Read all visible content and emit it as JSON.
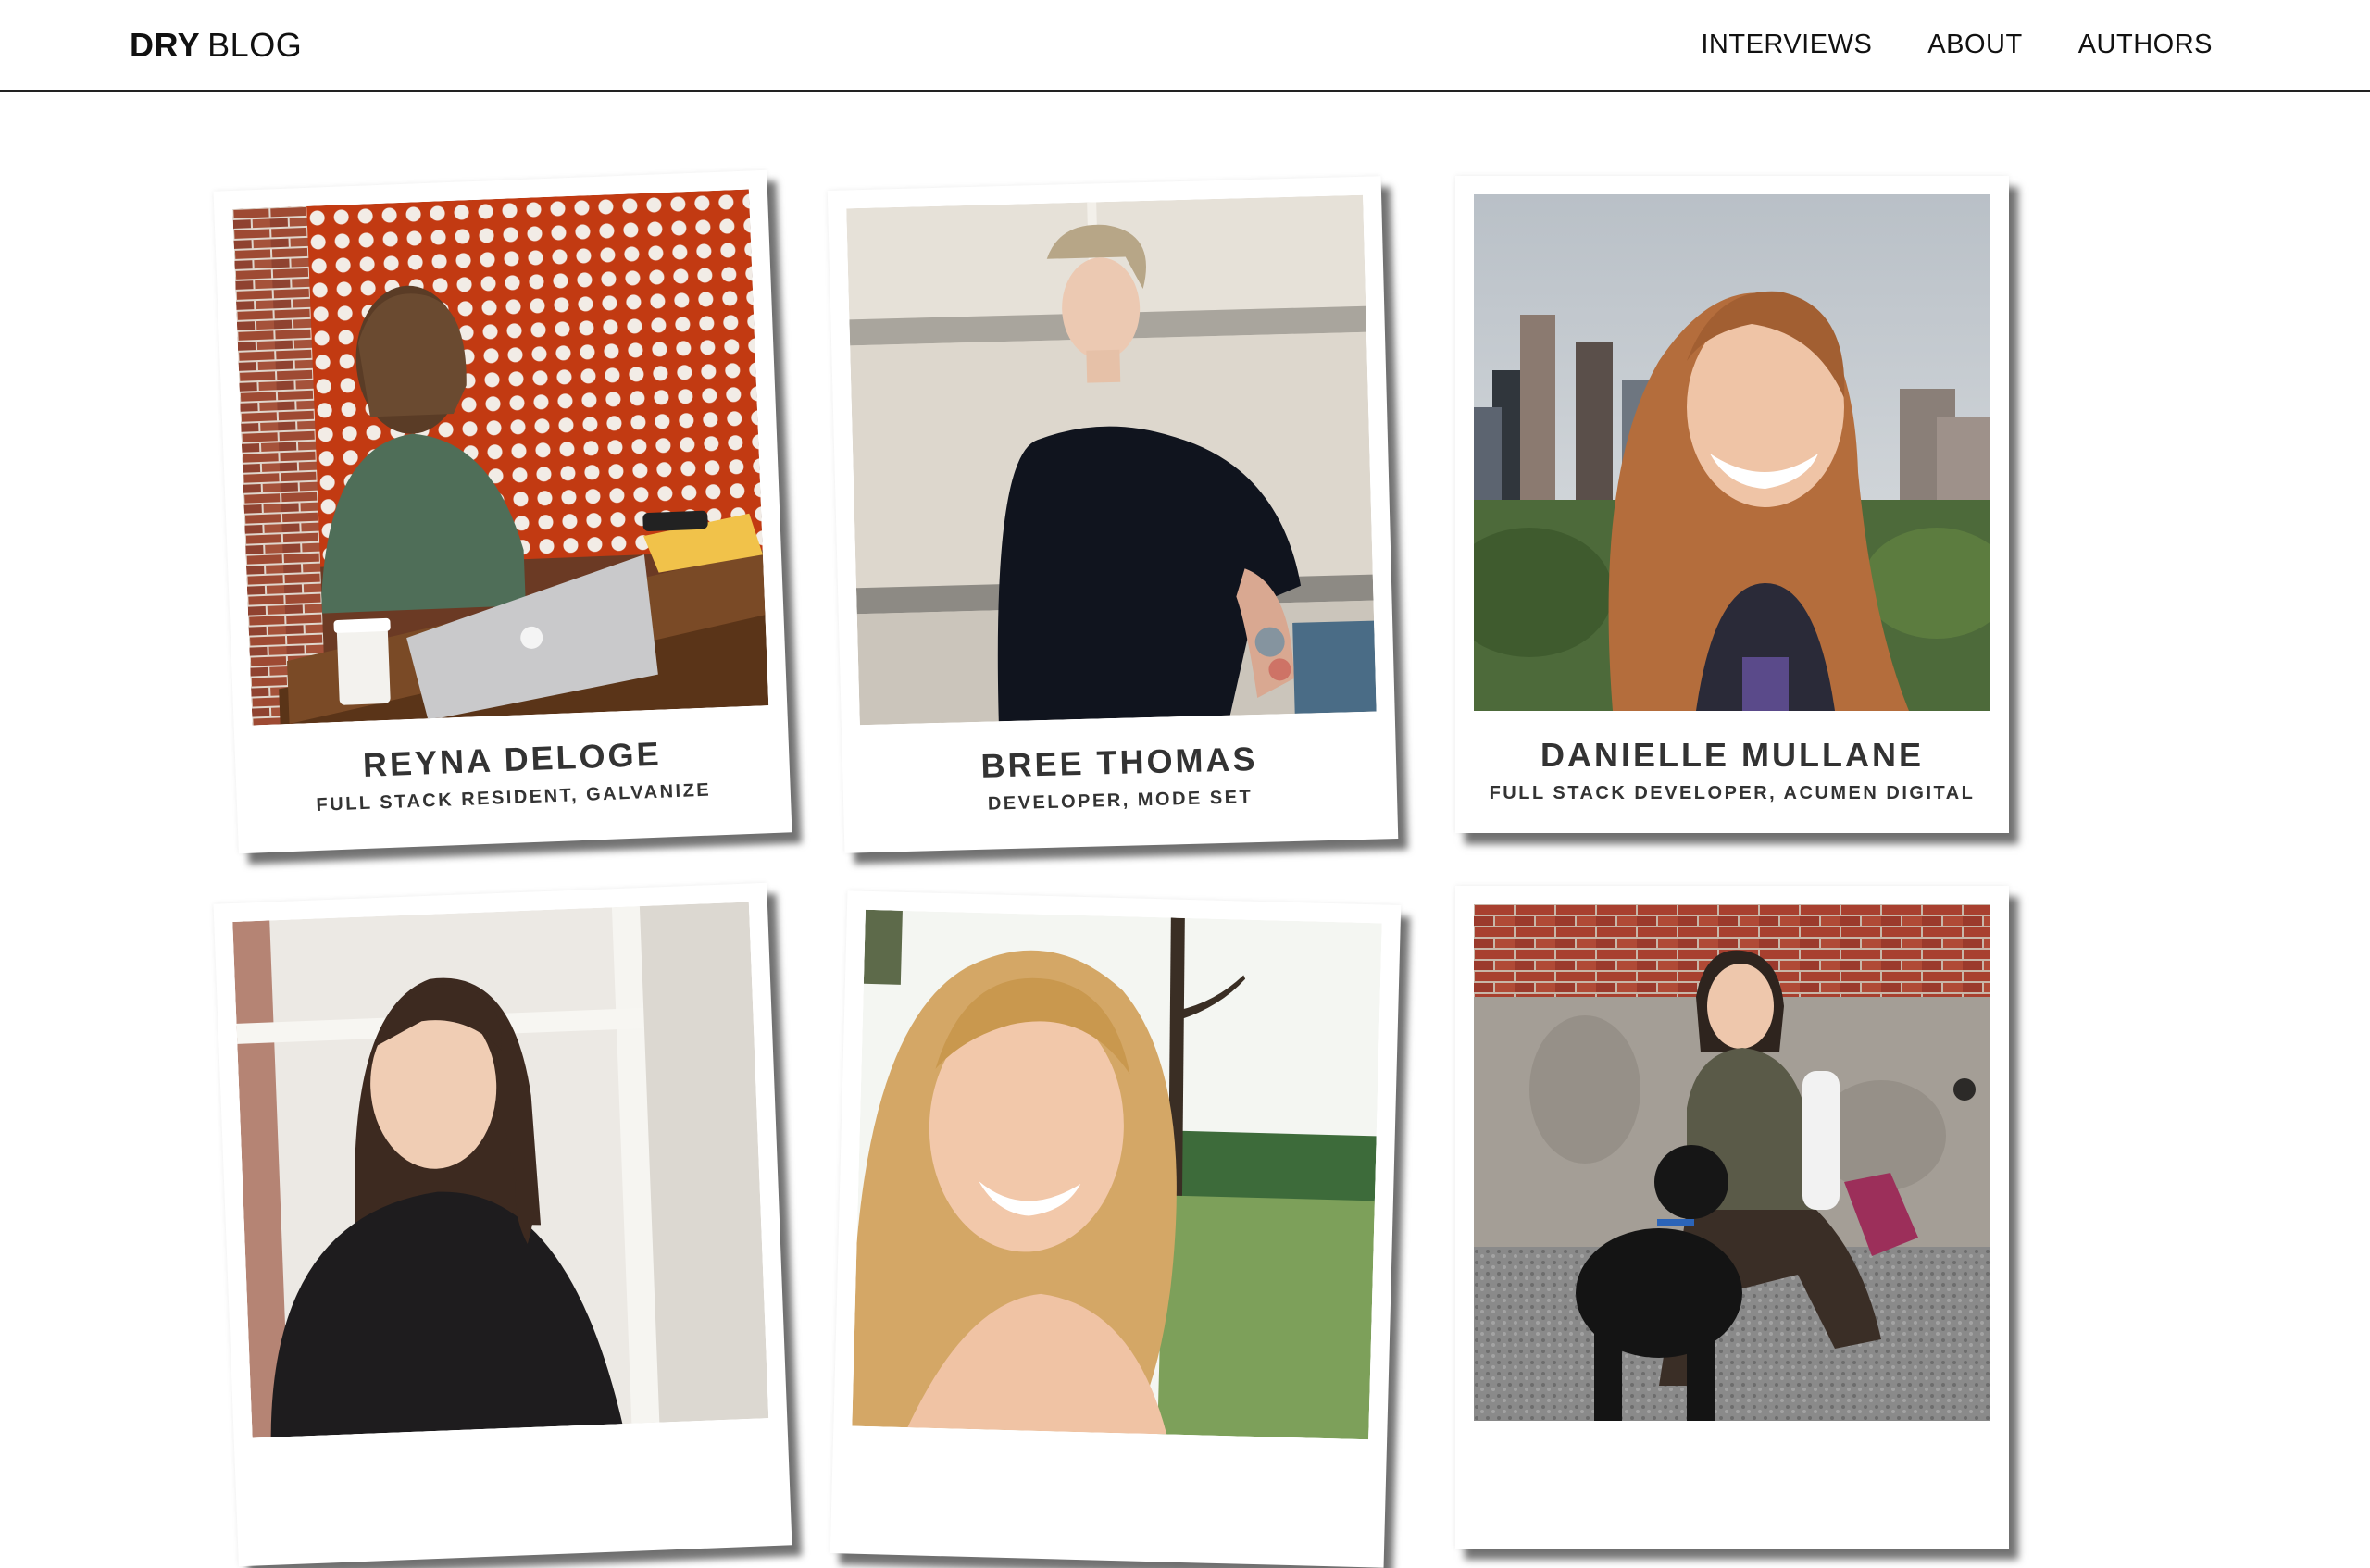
{
  "header": {
    "brand_bold": "DRY",
    "brand_light": "BLOG",
    "nav": [
      "INTERVIEWS",
      "ABOUT",
      "AUTHORS"
    ]
  },
  "cards": [
    {
      "name": "REYNA DELOGE",
      "role": "FULL STACK RESIDENT, GALVANIZE"
    },
    {
      "name": "BREE THOMAS",
      "role": "DEVELOPER, MODE SET"
    },
    {
      "name": "DANIELLE MULLANE",
      "role": "FULL STACK DEVELOPER, ACUMEN DIGITAL"
    },
    {
      "name": "",
      "role": ""
    },
    {
      "name": "",
      "role": ""
    },
    {
      "name": "",
      "role": ""
    }
  ],
  "colors": {
    "header_border": "#222222",
    "card_text": "#333333",
    "brick": "#a5452b",
    "panel_orange": "#c23a12"
  }
}
